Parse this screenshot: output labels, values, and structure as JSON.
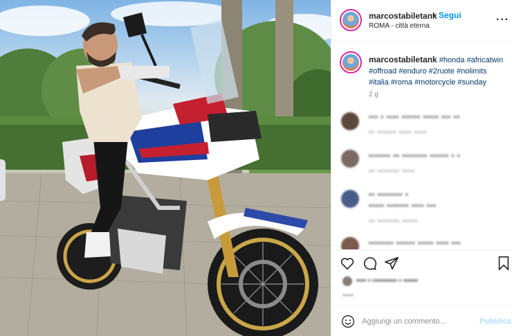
{
  "post": {
    "username": "marcostabiletank",
    "dot": "•",
    "follow_label": "Segui",
    "location": "ROMA - città eterna",
    "more_icon": "more-horizontal-icon",
    "more_label": "···"
  },
  "caption": {
    "username": "marcostabiletank",
    "hashtags": [
      "#honda",
      "#africatwin",
      "#offroad",
      "#enduro",
      "#2ruote",
      "#nolimits",
      "#italia",
      "#roma",
      "#motorcycle",
      "#sunday"
    ],
    "time": "2 g"
  },
  "comments": [
    {
      "line1": "▪▪▪ ▪ ▪▪▪▪ ▪▪▪▪▪▪ ▪▪▪▪▪ ▪▪▪ ▪▪",
      "line2": "▪▪ ▪▪▪▪▪▪ ▪▪▪▪ ▪▪▪▪",
      "avatar_color": "#5b4a3c"
    },
    {
      "line1": "▪▪▪▪▪▪▪ ▪▪ ▪▪▪▪▪▪▪▪ ▪▪▪▪▪▪ ▪ ▪",
      "line2": "▪▪ ▪▪▪▪▪▪▪ ▪▪▪▪",
      "avatar_color": "#7a6a62"
    },
    {
      "line1": "▪▪ ▪▪▪▪▪▪▪▪ ▪",
      "line2": "▪▪▪▪▪ ▪▪▪▪▪▪▪ ▪▪▪▪ ▪▪▪",
      "line3": "▪▪ ▪▪▪▪▪▪▪ ▪▪▪▪▪",
      "avatar_color": "#4a5d8a"
    },
    {
      "line1": "▪▪▪▪▪▪▪▪ ▪▪▪▪▪▪ ▪▪▪▪▪ ▪▪▪▪ ▪▪▪",
      "avatar_color": "#7c5a4e"
    }
  ],
  "actions": {
    "like_icon": "heart-icon",
    "comment_icon": "comment-icon",
    "share_icon": "send-icon",
    "save_icon": "bookmark-icon",
    "likes_text": "▪▪▪▪ ▪ ▪▪▪▪▪▪▪▪▪▪ ▪ ▪▪▪▪▪▪",
    "post_time": "▪▪▪▪▪"
  },
  "add_comment": {
    "emoji_icon": "smiley-icon",
    "placeholder": "Aggiungi un commento...",
    "publish_label": "Pubblica"
  },
  "colors": {
    "link": "#0095f6",
    "hashtag": "#00376b",
    "muted": "#8e8e8e",
    "publish_disabled": "#b2dffc",
    "avatar_ring": "#d6249f"
  }
}
